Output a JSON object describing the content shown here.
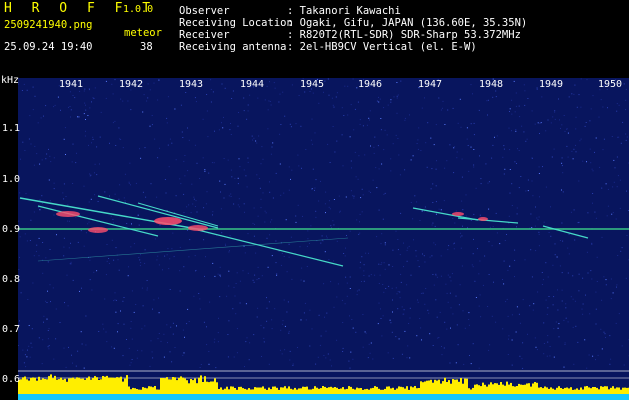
{
  "header": {
    "app_name": "H R O F F T",
    "app_version": "1.0.0",
    "filename": "2509241940.png",
    "datetime": "25.09.24 19:40",
    "meteor_label": "meteor",
    "meteor_count": "38",
    "fields": [
      {
        "label": "Observer",
        "value": ": Takanori Kawachi"
      },
      {
        "label": "Receiving Location",
        "value": ": Ogaki, Gifu, JAPAN (136.60E, 35.35N)"
      },
      {
        "label": "Receiver",
        "value": ": R820T2(RTL-SDR) SDR-Sharp 53.372MHz"
      },
      {
        "label": "Receiving antenna",
        "value": ": 2el-HB9CV Vertical (el. E-W)"
      }
    ]
  },
  "spectrogram": {
    "y_unit": "kHz",
    "y_ticks": [
      "1.1",
      "1.0",
      "0.9",
      "0.8",
      "0.7",
      "0.6"
    ],
    "x_ticks": [
      "1941",
      "1942",
      "1943",
      "1944",
      "1945",
      "1946",
      "1947",
      "1948",
      "1949",
      "1950"
    ],
    "colors": {
      "background": "#08155e",
      "carrier": "#3fd98a",
      "trail": "#46d9c8",
      "hot": "#ff4d6d",
      "level": "#ffee00",
      "level_base": "#15c8ff"
    }
  }
}
